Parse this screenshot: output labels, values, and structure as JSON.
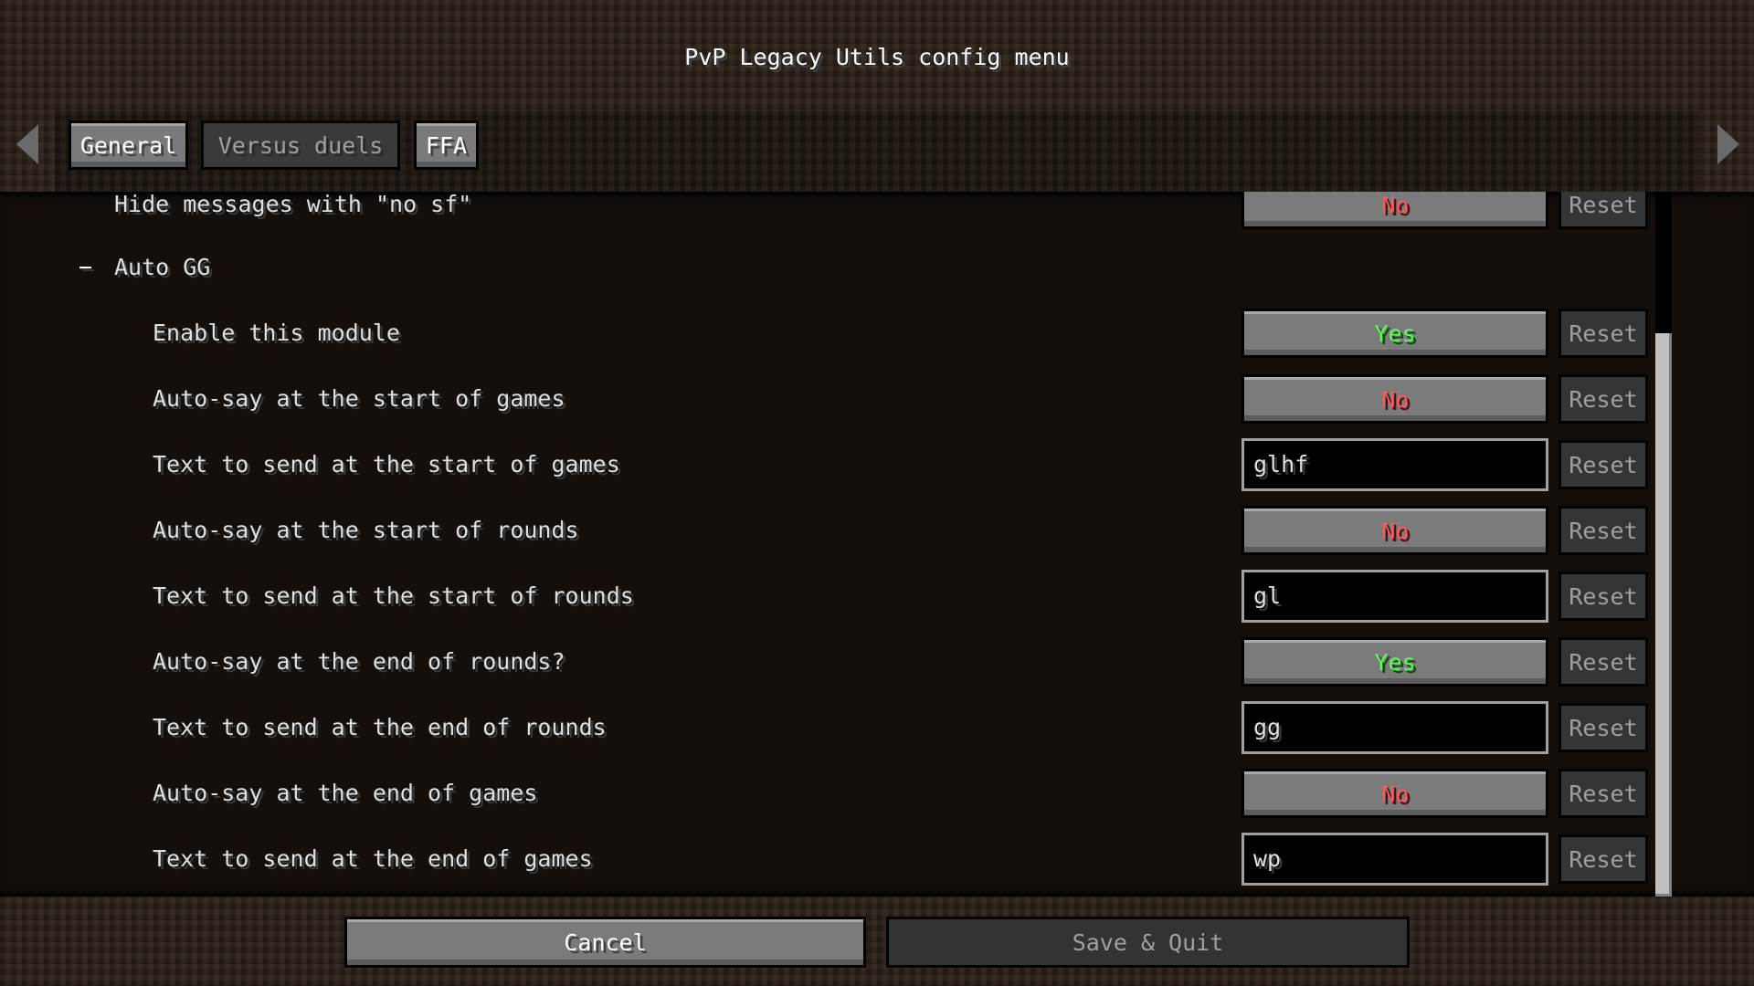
{
  "title": "PvP Legacy Utils config menu",
  "tabs": [
    {
      "label": "General",
      "active": true
    },
    {
      "label": "Versus duels",
      "active": false
    },
    {
      "label": "FFA",
      "active": true
    }
  ],
  "rows": [
    {
      "label": "Hide messages with \"no sf\"",
      "type": "toggle",
      "value": "No",
      "reset": "Reset"
    },
    {
      "label": "Auto GG",
      "type": "header",
      "collapse": "−"
    },
    {
      "label": "Enable this module",
      "type": "toggle",
      "value": "Yes",
      "reset": "Reset"
    },
    {
      "label": "Auto-say at the start of games",
      "type": "toggle",
      "value": "No",
      "reset": "Reset"
    },
    {
      "label": "Text to send at the start of games",
      "type": "text",
      "value": "glhf",
      "reset": "Reset"
    },
    {
      "label": "Auto-say at the start of rounds",
      "type": "toggle",
      "value": "No",
      "reset": "Reset"
    },
    {
      "label": "Text to send at the start of rounds",
      "type": "text",
      "value": "gl",
      "reset": "Reset"
    },
    {
      "label": "Auto-say at the end of rounds?",
      "type": "toggle",
      "value": "Yes",
      "reset": "Reset"
    },
    {
      "label": "Text to send at the end of rounds",
      "type": "text",
      "value": "gg",
      "reset": "Reset"
    },
    {
      "label": "Auto-say at the end of games",
      "type": "toggle",
      "value": "No",
      "reset": "Reset"
    },
    {
      "label": "Text to send at the end of games",
      "type": "text",
      "value": "wp",
      "reset": "Reset"
    }
  ],
  "footer": {
    "cancel": "Cancel",
    "save": "Save & Quit"
  },
  "colors": {
    "yes": "#55ff55",
    "no": "#ff5555"
  },
  "icons": {
    "left": "arrow-left-icon",
    "right": "arrow-right-icon"
  },
  "scroll_position_percent": 20
}
